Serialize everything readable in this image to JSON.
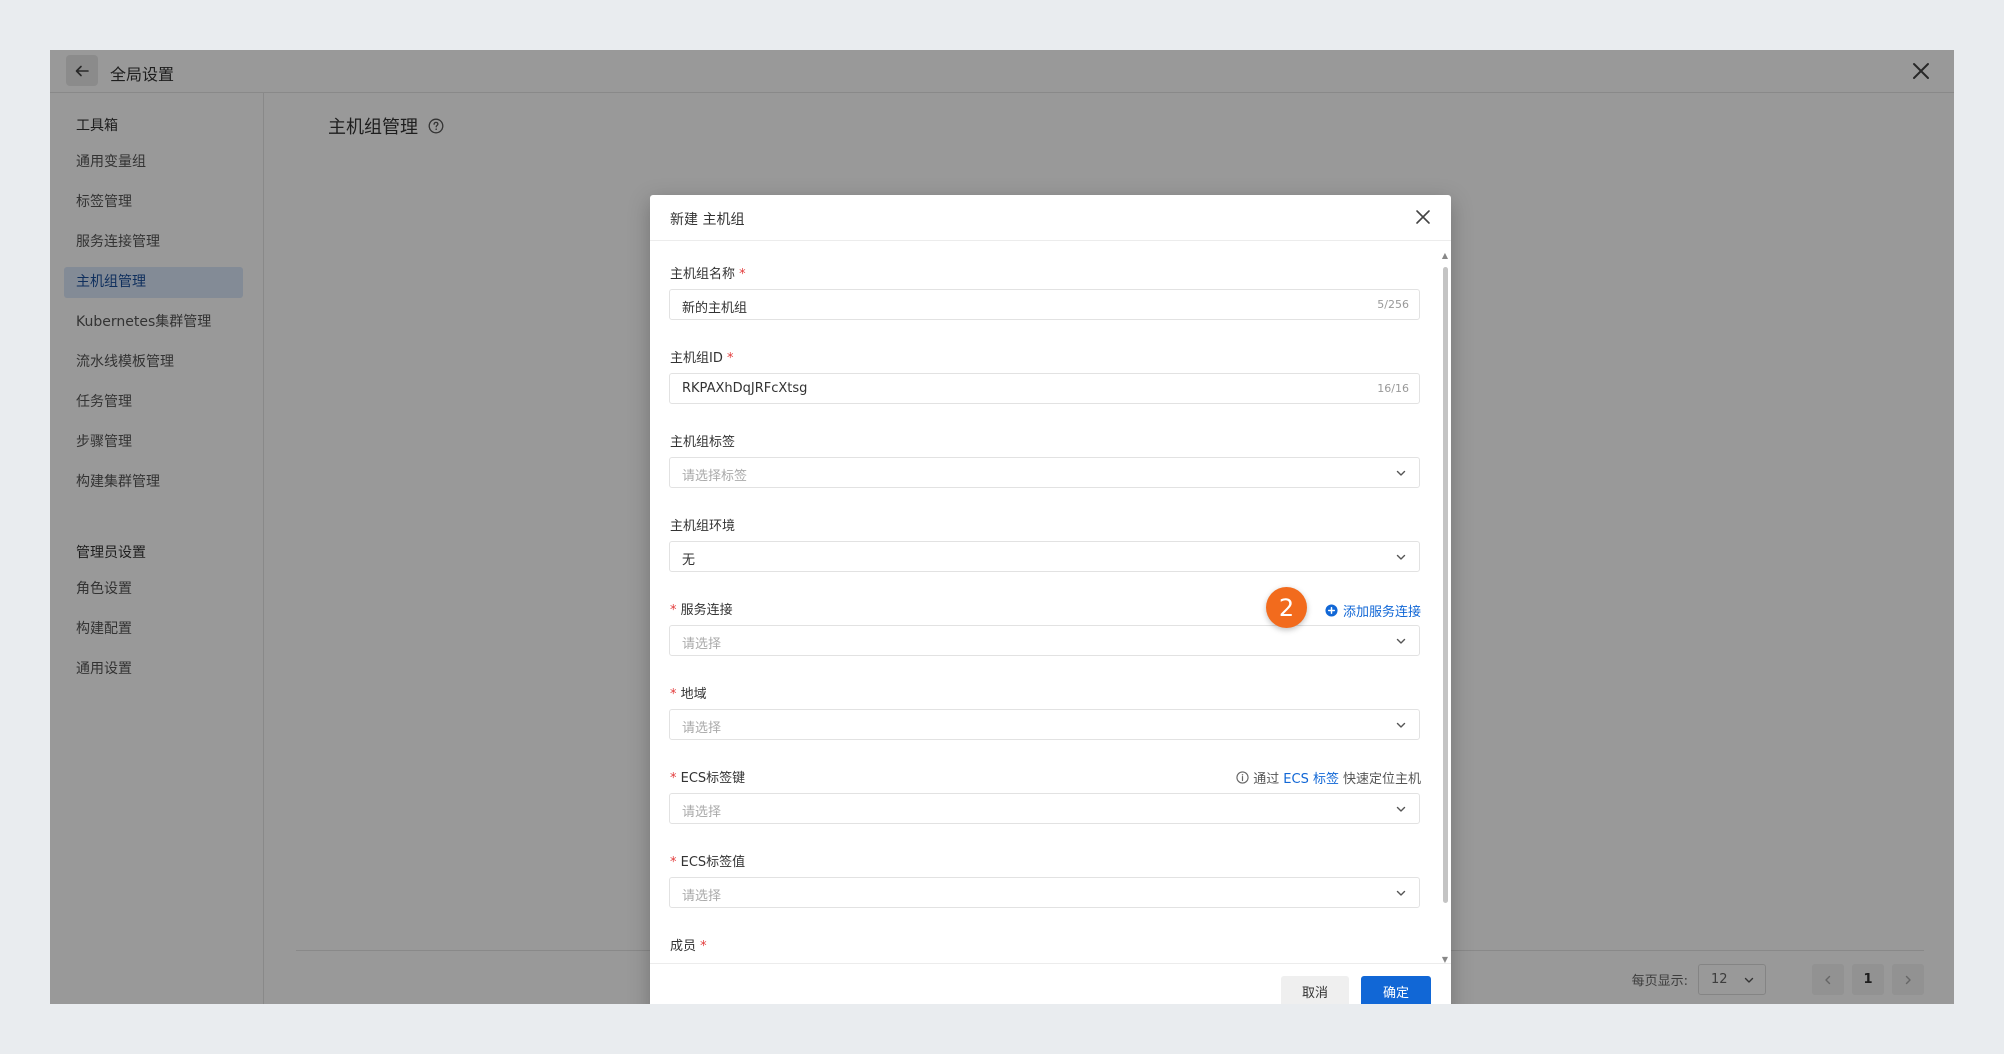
{
  "topbar": {
    "title": "全局设置"
  },
  "sidebar": {
    "group1_title": "工具箱",
    "items": [
      {
        "label": "通用变量组"
      },
      {
        "label": "标签管理"
      },
      {
        "label": "服务连接管理"
      },
      {
        "label": "主机组管理",
        "active": true
      },
      {
        "label": "Kubernetes集群管理"
      },
      {
        "label": "流水线模板管理"
      },
      {
        "label": "任务管理"
      },
      {
        "label": "步骤管理"
      },
      {
        "label": "构建集群管理"
      }
    ],
    "group2_title": "管理员设置",
    "admin_items": [
      {
        "label": "角色设置"
      },
      {
        "label": "构建配置"
      },
      {
        "label": "通用设置"
      }
    ]
  },
  "main": {
    "title": "主机组管理"
  },
  "pagination": {
    "per_page_label": "每页显示:",
    "page_size": "12",
    "current_page": "1"
  },
  "modal": {
    "title": "新建 主机组",
    "fields": {
      "name": {
        "label": "主机组名称",
        "required_mark": "*",
        "value": "新的主机组",
        "count": "5/256"
      },
      "id": {
        "label": "主机组ID",
        "required_mark": "*",
        "value": "RKPAXhDqJRFcXtsg",
        "count": "16/16"
      },
      "tags": {
        "label": "主机组标签",
        "placeholder": "请选择标签"
      },
      "env": {
        "label": "主机组环境",
        "value": "无"
      },
      "service_connection": {
        "required_mark": "*",
        "label": "服务连接",
        "placeholder": "请选择",
        "add_link": "添加服务连接"
      },
      "region": {
        "required_mark": "*",
        "label": "地域",
        "placeholder": "请选择"
      },
      "ecs_tag_key": {
        "required_mark": "*",
        "label": "ECS标签键",
        "placeholder": "请选择",
        "hint_prefix": "通过",
        "hint_link": "ECS 标签",
        "hint_suffix": "快速定位主机"
      },
      "ecs_tag_value": {
        "required_mark": "*",
        "label": "ECS标签值",
        "placeholder": "请选择"
      },
      "members": {
        "label": "成员",
        "required_mark": "*"
      }
    },
    "step_badge": "2",
    "cancel_label": "取消",
    "ok_label": "确定"
  },
  "colors": {
    "primary": "#1167d6",
    "required": "#e23b3b",
    "badge": "#f26b1d",
    "active_nav_bg": "#dbe8fb"
  },
  "icons": [
    "back-arrow-icon",
    "close-icon",
    "help-circle-icon",
    "chevron-down-icon",
    "chevron-left-icon",
    "chevron-right-icon",
    "plus-circle-icon",
    "info-icon"
  ]
}
